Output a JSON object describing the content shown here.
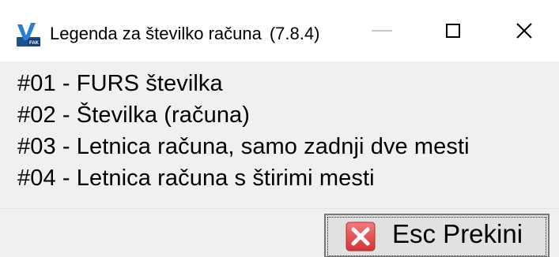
{
  "window": {
    "title": "Legenda za številko računa",
    "version": "(7.8.4)"
  },
  "titlebar_icons": {
    "app": "app-logo-icon",
    "minimize": "minimize-icon",
    "maximize": "maximize-icon",
    "close": "close-icon"
  },
  "legend": {
    "items": [
      "#01 - FURS številka",
      "#02 - Številka (računa)",
      "#03 - Letnica računa, samo zadnji dve mesti",
      "#04 - Letnica računa s štirimi mesti"
    ]
  },
  "footer": {
    "esc_button_label": "Esc Prekini",
    "esc_button_icon": "cancel-x-icon"
  },
  "colors": {
    "titlebar_bg": "#ffffff",
    "dialog_bg": "#f0f0f0",
    "button_bg": "#e1e1e1",
    "cancel_icon_red": "#e04848"
  }
}
